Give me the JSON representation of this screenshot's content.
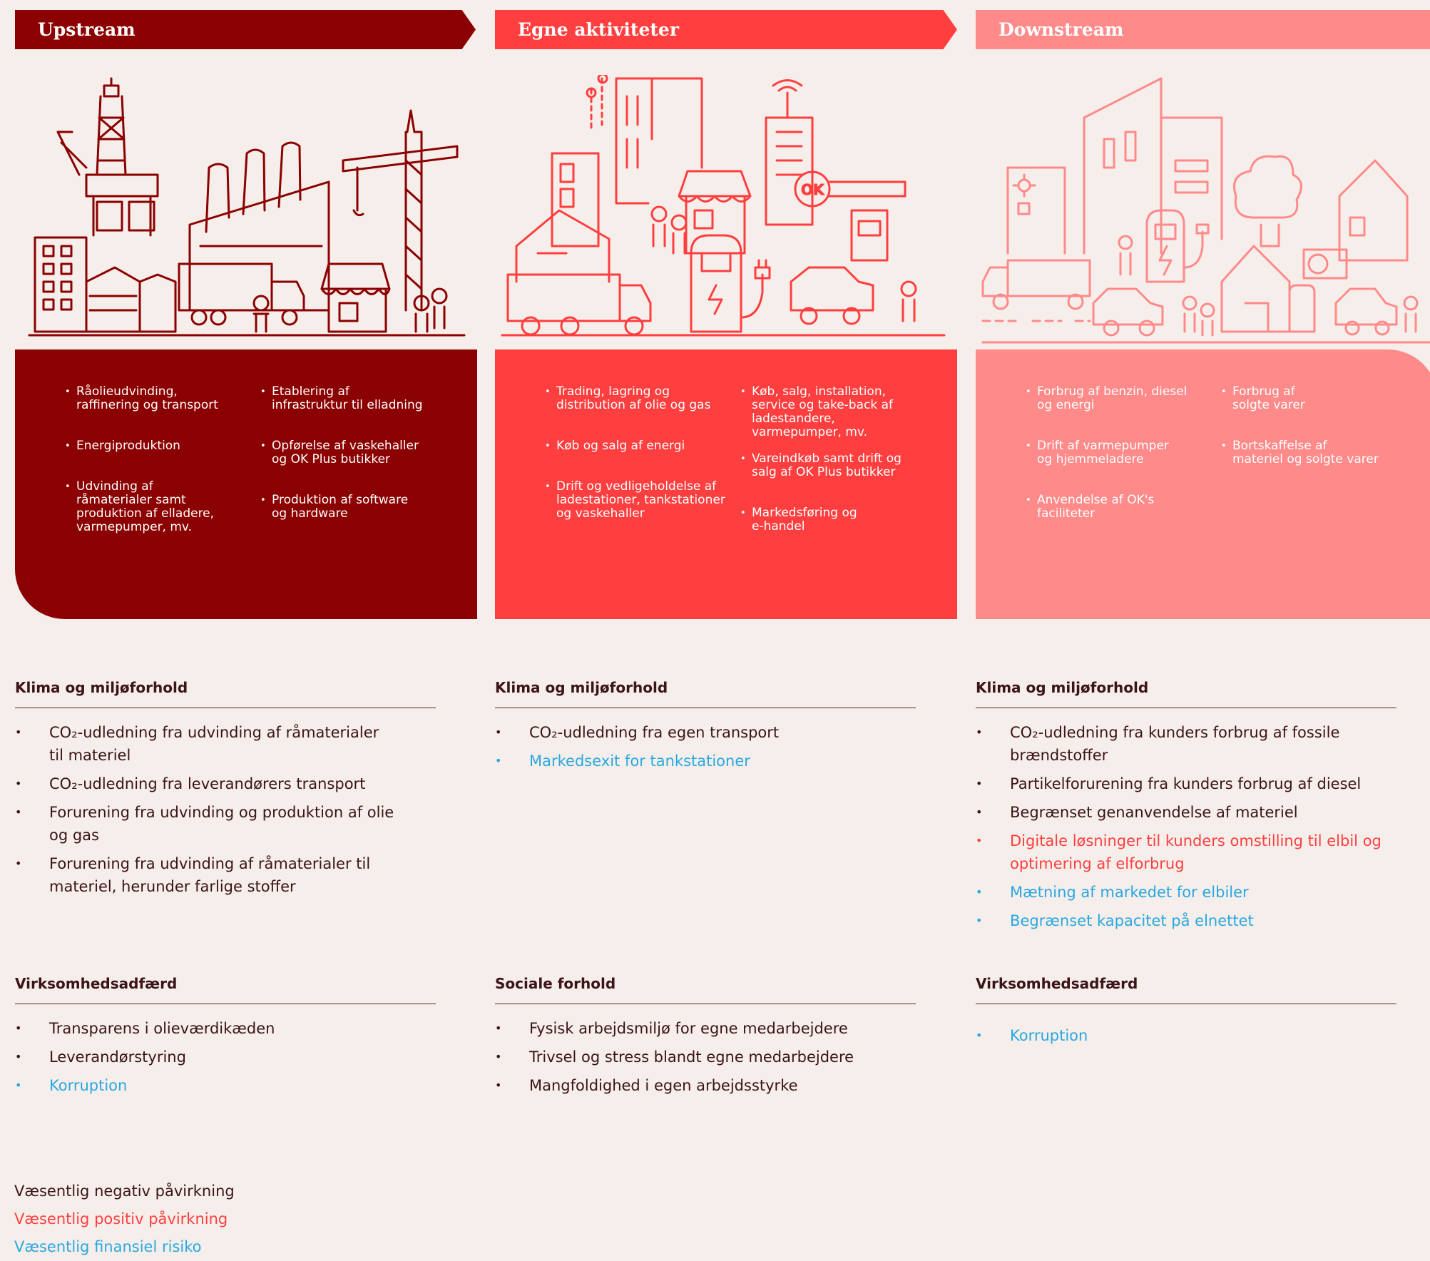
{
  "columns": {
    "upstream": {
      "title": "Upstream",
      "color": "#8b0000",
      "box_left": [
        "Råolieudvinding,\nraffinering og transport",
        "Energiproduktion",
        "Udvinding af\nråmaterialer samt\nproduktion af elladere,\nvarmepumper, mv."
      ],
      "box_right": [
        "Etablering af\ninfrastruktur til elladning",
        "Opførelse af vaskehaller\nog OK Plus butikker",
        "Produktion af software\nog hardware"
      ]
    },
    "own": {
      "title": "Egne aktiviteter",
      "color": "#ff3f3f",
      "box_left": [
        "Trading, lagring og\ndistribution af olie og gas",
        "Køb og salg af energi",
        "Drift og vedligeholdelse af\nladestationer, tankstationer\nog vaskehaller"
      ],
      "box_right": [
        "Køb, salg, installation,\nservice og take-back af\nladestandere,\nvarmepumper, mv.",
        "Vareindkøb samt drift og\nsalg af OK Plus butikker",
        "Markedsføring og\ne-handel"
      ]
    },
    "downstream": {
      "title": "Downstream",
      "color": "#ff8a8a",
      "box_left": [
        "Forbrug af benzin, diesel\nog energi",
        "Drift af varmepumper\nog hjemmeladere",
        "Anvendelse af OK's\nfaciliteter"
      ],
      "box_right": [
        "Forbrug af\nsolgte varer",
        "Bortskaffelse af\nmateriel og solgte varer"
      ]
    }
  },
  "sections": {
    "up_klima": {
      "title": "Klima og miljøforhold",
      "items": [
        {
          "text": "CO₂-udledning fra udvinding af råmaterialer\ntil materiel",
          "kind": "neg"
        },
        {
          "text": "CO₂-udledning fra leverandørers transport",
          "kind": "neg"
        },
        {
          "text": "Forurening fra udvinding og produktion af olie\nog gas",
          "kind": "neg"
        },
        {
          "text": "Forurening fra udvinding af råmaterialer til\nmateriel, herunder farlige stoffer",
          "kind": "neg"
        }
      ]
    },
    "own_klima": {
      "title": "Klima og miljøforhold",
      "items": [
        {
          "text": "CO₂-udledning fra egen transport",
          "kind": "neg"
        },
        {
          "text": "Markedsexit for tankstationer",
          "kind": "fin"
        }
      ]
    },
    "down_klima": {
      "title": "Klima og miljøforhold",
      "items": [
        {
          "text": "CO₂-udledning fra kunders forbrug af fossile\nbrændstoffer",
          "kind": "neg"
        },
        {
          "text": "Partikelforurening fra kunders forbrug af diesel",
          "kind": "neg"
        },
        {
          "text": "Begrænset genanvendelse af materiel",
          "kind": "neg"
        },
        {
          "text": "Digitale løsninger til kunders omstilling til elbil og\noptimering af elforbrug",
          "kind": "pos"
        },
        {
          "text": "Mætning af markedet for elbiler",
          "kind": "fin"
        },
        {
          "text": "Begrænset kapacitet på elnettet",
          "kind": "fin"
        }
      ]
    },
    "up_adfaerd": {
      "title": "Virksomhedsadfærd",
      "items": [
        {
          "text": "Transparens i olieværdikæden",
          "kind": "neg"
        },
        {
          "text": "Leverandørstyring",
          "kind": "neg"
        },
        {
          "text": "Korruption",
          "kind": "fin"
        }
      ]
    },
    "own_sociale": {
      "title": "Sociale forhold",
      "items": [
        {
          "text": "Fysisk arbejdsmiljø for egne medarbejdere",
          "kind": "neg"
        },
        {
          "text": "Trivsel og stress blandt egne medarbejdere",
          "kind": "neg"
        },
        {
          "text": "Mangfoldighed i egen arbejdsstyrke",
          "kind": "neg"
        }
      ]
    },
    "down_adfaerd": {
      "title": "Virksomhedsadfærd",
      "items": [
        {
          "text": "Korruption",
          "kind": "fin"
        }
      ]
    }
  },
  "legend": {
    "negative": "Væsentlig negativ påvirkning",
    "positive": "Væsentlig positiv påvirkning",
    "financial": "Væsentlig finansiel risiko"
  },
  "colors": {
    "negative": "#3a1416",
    "positive": "#ff3f3f",
    "financial": "#29a8e0"
  }
}
